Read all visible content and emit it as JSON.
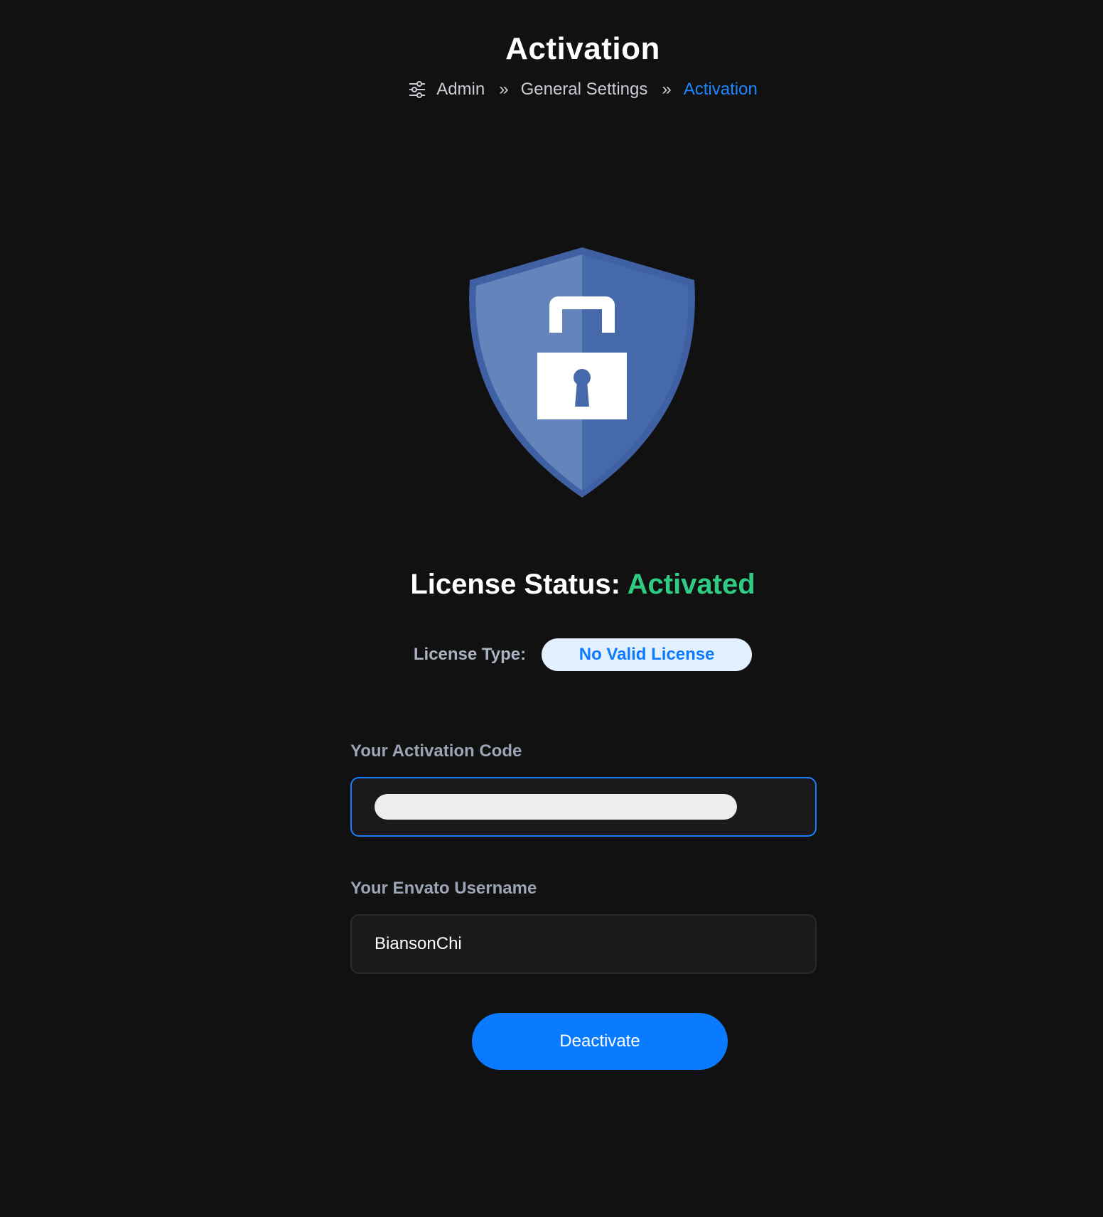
{
  "header": {
    "title": "Activation",
    "breadcrumb": [
      "Admin",
      "General Settings",
      "Activation"
    ],
    "separator": "»"
  },
  "license": {
    "status_label": "License Status:",
    "status_value": "Activated",
    "type_label": "License Type:",
    "type_value": "No Valid License"
  },
  "form": {
    "activation_code_label": "Your Activation Code",
    "envato_username_label": "Your Envato Username",
    "envato_username_value": "BiansonChi"
  },
  "actions": {
    "deactivate_label": "Deactivate"
  },
  "colors": {
    "background": "#111111",
    "accent": "#0a7bff",
    "success": "#2fcb83",
    "shield_light": "#6485bb",
    "shield_dark": "#4569aa"
  }
}
